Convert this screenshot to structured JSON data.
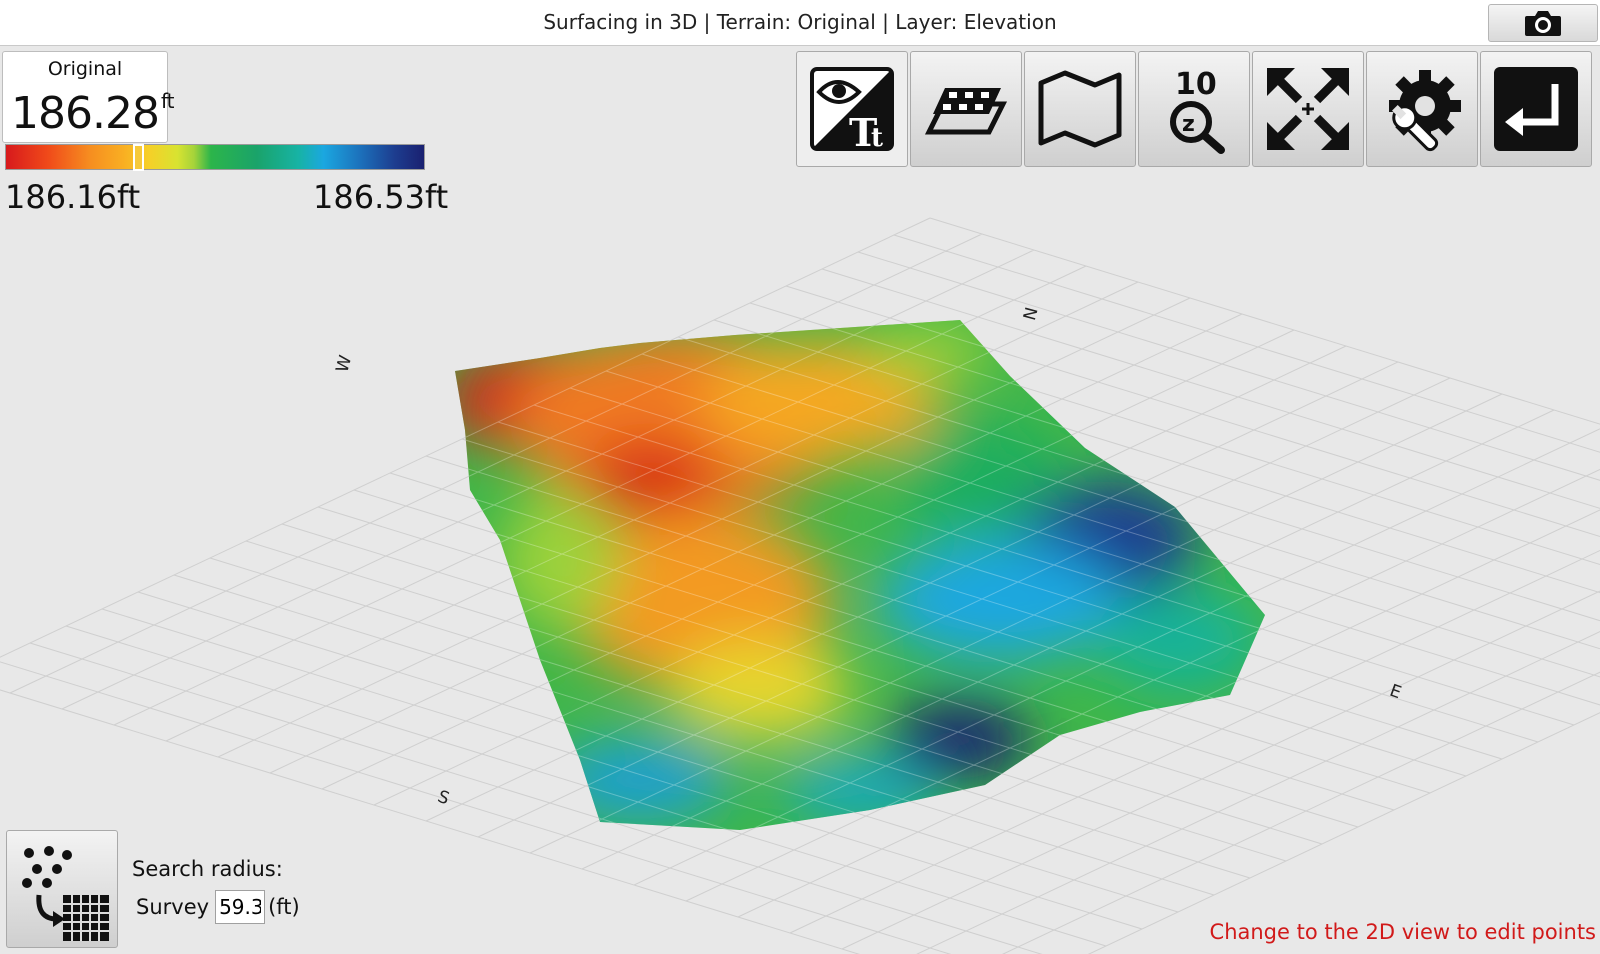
{
  "window": {
    "title": "Surfacing in 3D | Terrain: Original | Layer: Elevation"
  },
  "readout": {
    "label": "Original",
    "value": "186.28",
    "unit": "ft"
  },
  "legend": {
    "min_label": "186.16ft",
    "max_label": "186.53ft",
    "marker_fraction": 0.32
  },
  "compass": {
    "north": "N",
    "south": "S",
    "east": "E",
    "west": "W"
  },
  "toolbar": {
    "buttons": [
      {
        "name": "visibility-text-button",
        "icon": "eye-text-icon"
      },
      {
        "name": "layers-button",
        "icon": "layers-icon"
      },
      {
        "name": "map-button",
        "icon": "map-icon"
      },
      {
        "name": "zoom-button",
        "icon": "zoom-10-icon",
        "label": "10"
      },
      {
        "name": "fit-extent-button",
        "icon": "expand-arrows-icon"
      },
      {
        "name": "settings-button",
        "icon": "wrench-gear-icon"
      },
      {
        "name": "return-button",
        "icon": "return-arrow-icon"
      }
    ]
  },
  "search": {
    "label": "Search radius:",
    "source": "Survey",
    "value": "59.3",
    "unit": "(ft)"
  },
  "hint": "Change to the 2D view to edit points",
  "colors": {
    "hint": "#d11a1a",
    "low": "#d7191c",
    "mid": "#2cb54a",
    "high": "#1a2070"
  }
}
